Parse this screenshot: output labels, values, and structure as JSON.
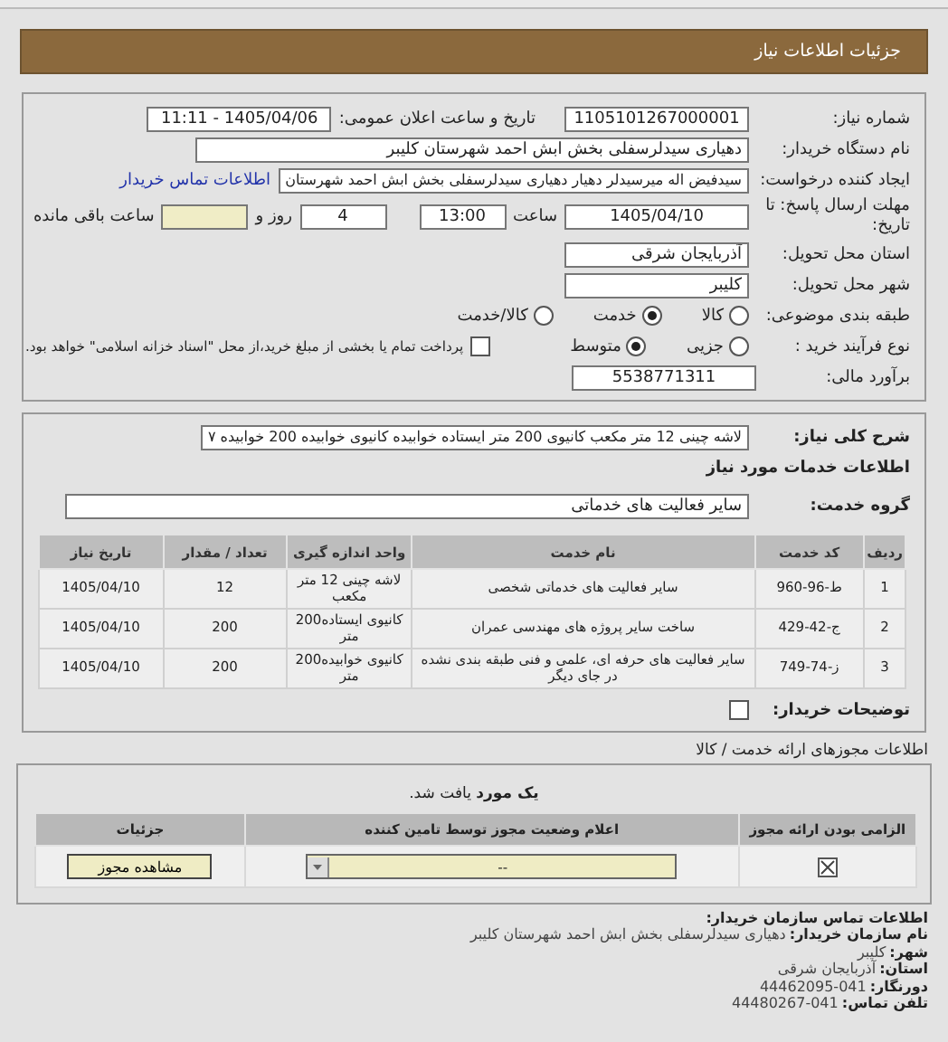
{
  "header": {
    "title": "جزئیات اطلاعات نیاز"
  },
  "need_number": {
    "label": "شماره نیاز:",
    "value": "1105101267000001"
  },
  "announce": {
    "label": "تاریخ و ساعت اعلان عمومی:",
    "value": "1405/04/06 - 11:11"
  },
  "buyer_org": {
    "label": "نام دستگاه خریدار:",
    "value": "دهیاری سیدلرسفلی بخش ابش احمد شهرستان کلیبر"
  },
  "requester": {
    "label": "ایجاد کننده درخواست:",
    "value": "سیدفیض اله میرسیدلر دهیار دهیاری سیدلرسفلی بخش ابش احمد شهرستان",
    "link": "اطلاعات تماس خریدار"
  },
  "deadline": {
    "label": "مهلت ارسال پاسخ: تا تاریخ:",
    "date": "1405/04/10",
    "time_label": "ساعت",
    "time": "13:00",
    "days": "4",
    "days_label": "روز و",
    "remaining_label": "ساعت باقی مانده"
  },
  "province": {
    "label": "استان محل تحویل:",
    "value": "آذربایجان شرقی"
  },
  "city": {
    "label": "شهر محل تحویل:",
    "value": "کلیبر"
  },
  "category": {
    "label": "طبقه بندی موضوعی:",
    "options": [
      {
        "label": "کالا",
        "selected": false
      },
      {
        "label": "خدمت",
        "selected": true
      },
      {
        "label": "کالا/خدمت",
        "selected": false
      }
    ]
  },
  "purchase_type": {
    "label": "نوع فرآیند خرید :",
    "options": [
      {
        "label": "جزیی",
        "selected": false
      },
      {
        "label": "متوسط",
        "selected": true
      }
    ],
    "payment": {
      "checked": false,
      "text": "پرداخت تمام یا بخشی از مبلغ خرید،از محل \"اسناد خزانه اسلامی\" خواهد بود."
    }
  },
  "budget": {
    "label": "برآورد مالی:",
    "value": "5538771311"
  },
  "summary": {
    "label": "شرح کلی نیاز:",
    "value": "لاشه چینی 12 متر مکعب کانیوی 200 متر ایستاده خوابیده کانیوی خوابیده 200 خوابیده ۷"
  },
  "services_title": "اطلاعات خدمات مورد نیاز",
  "service_group": {
    "label": "گروه خدمت:",
    "value": "سایر فعالیت های خدماتی"
  },
  "table": {
    "columns": [
      "ردیف",
      "کد خدمت",
      "نام خدمت",
      "واحد اندازه گیری",
      "تعداد / مقدار",
      "تاریخ نیاز"
    ],
    "rows": [
      [
        "1",
        "ط-96-960",
        "سایر فعالیت های خدماتی شخصی",
        "لاشه چینی 12 متر مکعب",
        "12",
        "1405/04/10"
      ],
      [
        "2",
        "ج-42-429",
        "ساخت سایر پروژه های مهندسی عمران",
        "کانیوی ایستاده200 متر",
        "200",
        "1405/04/10"
      ],
      [
        "3",
        "ز-74-749",
        "سایر فعالیت های حرفه ای، علمی و فنی طبقه بندی نشده در جای دیگر",
        "کانیوی خوابیده200 متر",
        "200",
        "1405/04/10"
      ]
    ]
  },
  "buyer_notes": {
    "label": "توضیحات خریدار:",
    "checked": false
  },
  "permits_title": "اطلاعات مجوزهای ارائه خدمت / کالا",
  "permits": {
    "found": "**یک مورد** یافت شد.",
    "columns": [
      "الزامی بودن ارائه مجوز",
      "اعلام وضعیت مجوز توسط تامین کننده",
      "جزئیات"
    ],
    "rows": [
      {
        "required": true,
        "status": "--",
        "button": "مشاهده مجوز"
      }
    ]
  },
  "contact": {
    "title": "اطلاعات تماس سازمان خریدار:",
    "lines": [
      {
        "label": "نام سازمان خریدار:",
        "value": "دهیاری سیدلرسفلی بخش ابش احمد شهرستان کلیبر"
      },
      {
        "label": "شهر:",
        "value": "کلیبر"
      },
      {
        "label": "استان:",
        "value": "آذربایجان شرقی"
      },
      {
        "label": "دورنگار:",
        "value": "041-44462095"
      },
      {
        "label": "تلفن تماس:",
        "value": "041-44480267"
      }
    ]
  }
}
